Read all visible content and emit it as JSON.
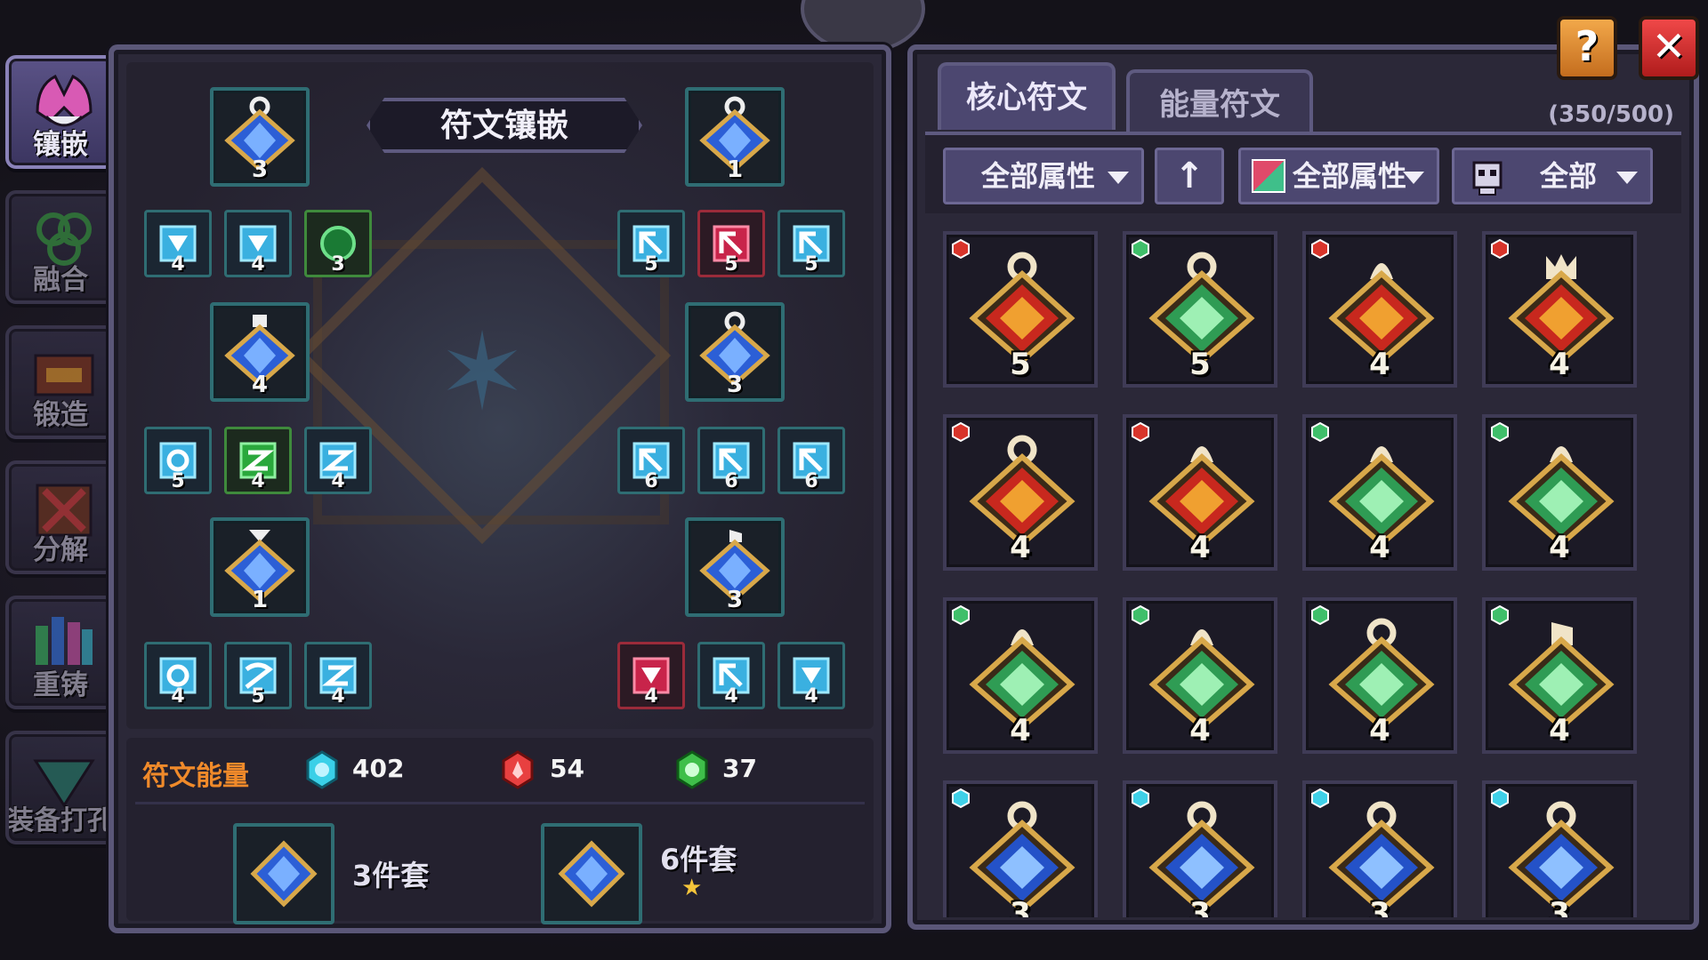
{
  "sidenav": [
    {
      "label": "镶嵌",
      "icon": "inlay-icon",
      "active": true
    },
    {
      "label": "融合",
      "icon": "fusion-icon",
      "active": false
    },
    {
      "label": "锻造",
      "icon": "forge-icon",
      "active": false
    },
    {
      "label": "分解",
      "icon": "decompose-icon",
      "active": false
    },
    {
      "label": "重铸",
      "icon": "recast-icon",
      "active": false
    },
    {
      "label": "装备打孔",
      "icon": "socket-icon",
      "active": false
    }
  ],
  "board": {
    "title": "符文镶嵌",
    "core_slots": [
      "3",
      "1",
      "4",
      "3",
      "1",
      "3"
    ],
    "energy_slots": {
      "group1": [
        "4",
        "4",
        "3"
      ],
      "group2": [
        "5",
        "5",
        "5"
      ],
      "group3": [
        "5",
        "4",
        "4"
      ],
      "group4": [
        "6",
        "6",
        "6"
      ],
      "group5": [
        "4",
        "5",
        "4"
      ],
      "group6": [
        "4",
        "4",
        "4"
      ]
    }
  },
  "energy": {
    "label": "符文能量",
    "blue": "402",
    "red": "54",
    "green": "37"
  },
  "sets": [
    {
      "label": "3件套",
      "star": false
    },
    {
      "label": "6件套",
      "star": true
    }
  ],
  "tabs": [
    "核心符文",
    "能量符文"
  ],
  "capacity": "(350/500)",
  "filters": {
    "attr1": "全部属性",
    "sort_icon": "arrow-up-icon",
    "attr2": "全部属性",
    "type": "全部"
  },
  "runes": [
    {
      "element": "fire",
      "level": "5",
      "shape": "ring"
    },
    {
      "element": "leaf",
      "level": "5",
      "shape": "ring"
    },
    {
      "element": "fire",
      "level": "4",
      "shape": "bell"
    },
    {
      "element": "fire",
      "level": "4",
      "shape": "crown"
    },
    {
      "element": "fire",
      "level": "4",
      "shape": "ring"
    },
    {
      "element": "fire",
      "level": "4",
      "shape": "bell"
    },
    {
      "element": "leaf",
      "level": "4",
      "shape": "bell"
    },
    {
      "element": "leaf",
      "level": "4",
      "shape": "bell"
    },
    {
      "element": "leaf",
      "level": "4",
      "shape": "bell"
    },
    {
      "element": "leaf",
      "level": "4",
      "shape": "bell"
    },
    {
      "element": "leaf",
      "level": "4",
      "shape": "ring"
    },
    {
      "element": "leaf",
      "level": "4",
      "shape": "flag"
    },
    {
      "element": "ice",
      "level": "3",
      "shape": "ring"
    },
    {
      "element": "ice",
      "level": "3",
      "shape": "ring"
    },
    {
      "element": "ice",
      "level": "3",
      "shape": "ring"
    },
    {
      "element": "ice",
      "level": "3",
      "shape": "ring"
    }
  ],
  "colors": {
    "fire": "#d8342a",
    "leaf": "#3fbf6a",
    "ice": "#3a7cf0",
    "accent": "#f08a2a"
  },
  "buttons": {
    "help": "?",
    "close": "✕"
  }
}
